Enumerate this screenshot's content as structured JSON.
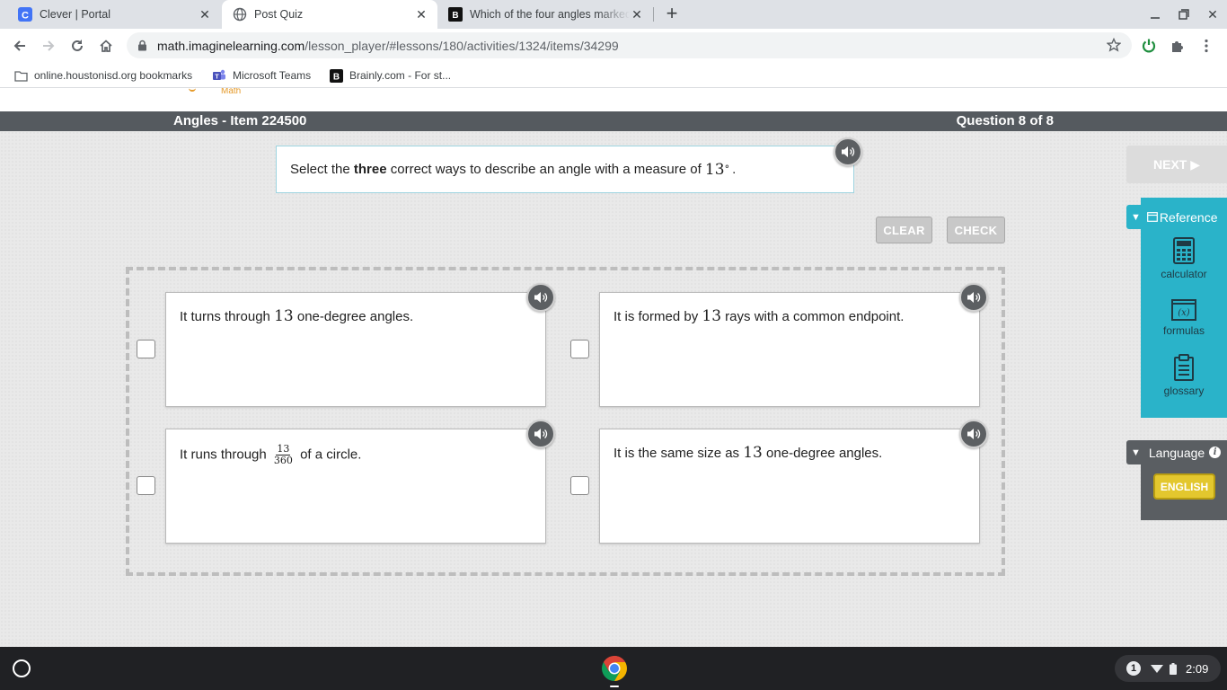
{
  "browser": {
    "tabs": [
      {
        "title": "Clever | Portal",
        "active": false
      },
      {
        "title": "Post Quiz",
        "active": true
      },
      {
        "title": "Which of the four angles marked",
        "active": false
      }
    ],
    "url": {
      "host": "math.imaginelearning.com",
      "path": "/lesson_player/#lessons/180/activities/1324/items/34299"
    },
    "bookmarks": [
      {
        "label": "online.houstonisd.org bookmarks"
      },
      {
        "label": "Microsoft Teams"
      },
      {
        "label": "Brainly.com - For st..."
      }
    ],
    "colors": {
      "tabstrip": "#dee1e6",
      "omnibox": "#f1f3f4"
    }
  },
  "page": {
    "logo_fragment": "Math",
    "header": {
      "left": "Angles - Item 224500",
      "right": "Question 8 of 8"
    },
    "prompt": {
      "pre": "Select the ",
      "bold": "three",
      "post": " correct ways to describe an angle with a measure of ",
      "value": "13",
      "degree": "°",
      "end": "."
    },
    "buttons": {
      "clear": "CLEAR",
      "check": "CHECK",
      "next": "NEXT ▶"
    },
    "options": [
      {
        "pre": "It turns through ",
        "num": "13",
        "post": " one-degree angles."
      },
      {
        "pre": "It is formed by ",
        "num": "13",
        "post": " rays with a common endpoint."
      },
      {
        "pre": "It runs through ",
        "frac_num": "13",
        "frac_den": "360",
        "post": " of a circle."
      },
      {
        "pre": "It is the same size as ",
        "num": "13",
        "post": " one-degree angles."
      }
    ],
    "reference": {
      "title": "Reference",
      "items": [
        {
          "label": "calculator",
          "icon": "calculator-icon"
        },
        {
          "label": "formulas",
          "icon": "formulas-icon"
        },
        {
          "label": "glossary",
          "icon": "glossary-icon"
        }
      ]
    },
    "language": {
      "title": "Language",
      "current": "ENGLISH"
    },
    "colors": {
      "accent": "#2ab3c9",
      "header": "#555a5f",
      "language_button": "#e3c72e"
    }
  },
  "shelf": {
    "notification_count": "1",
    "time": "2:09"
  }
}
